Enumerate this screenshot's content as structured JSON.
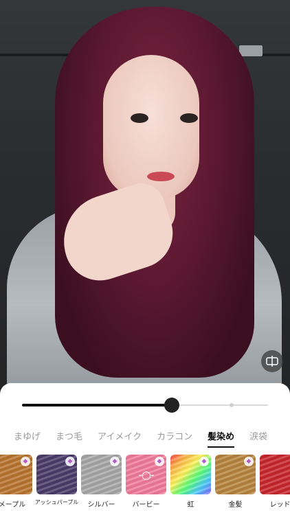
{
  "icons": {
    "compare": "compare-split-icon",
    "premium": "diamond-icon"
  },
  "slider": {
    "value_percent": 61
  },
  "tabs": [
    {
      "label": "まゆげ",
      "active": false
    },
    {
      "label": "まつ毛",
      "active": false
    },
    {
      "label": "アイメイク",
      "active": false
    },
    {
      "label": "カラコン",
      "active": false
    },
    {
      "label": "髪染め",
      "active": true
    },
    {
      "label": "涙袋",
      "active": false
    }
  ],
  "swatches": [
    {
      "label": "メープル",
      "color": "#b8742e",
      "premium": true
    },
    {
      "label": "アッシュパープル",
      "color": "#4b3a6a",
      "premium": true
    },
    {
      "label": "シルバー",
      "color": "#a7a7a7",
      "premium": true
    },
    {
      "label": "バービー",
      "color": "#f07a9a",
      "premium": true,
      "symbol": "-○-"
    },
    {
      "label": "虹",
      "color": "rainbow",
      "premium": true
    },
    {
      "label": "金髪",
      "color": "#b8843e",
      "premium": true
    },
    {
      "label": "レッド",
      "color": "#c7262c",
      "premium": false
    }
  ]
}
